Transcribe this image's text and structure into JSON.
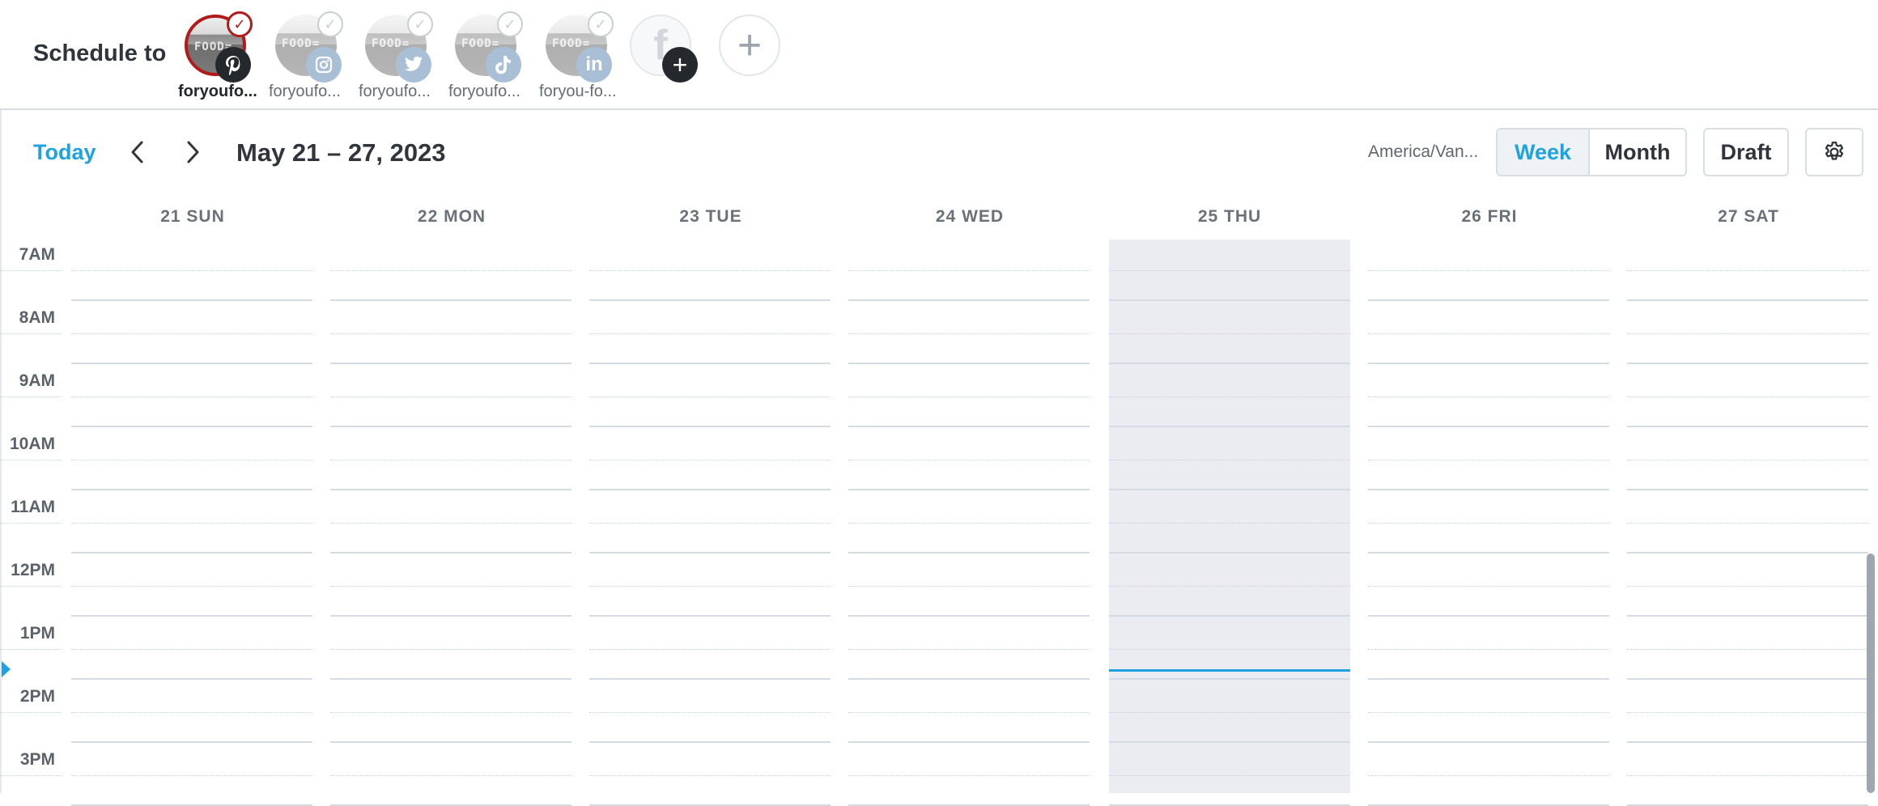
{
  "header": {
    "schedule_label": "Schedule to",
    "accounts": [
      {
        "name": "foryoufo...",
        "network_icon": "pinterest-icon",
        "selected": true
      },
      {
        "name": "foryoufo...",
        "network_icon": "instagram-icon",
        "selected": false
      },
      {
        "name": "foryoufo...",
        "network_icon": "twitter-icon",
        "selected": false
      },
      {
        "name": "foryoufo...",
        "network_icon": "tiktok-icon",
        "selected": false
      },
      {
        "name": "foryou-fo...",
        "network_icon": "linkedin-icon",
        "selected": false
      }
    ],
    "avatar_sign_text": "FOOD=",
    "add_facebook_icon": "facebook-icon",
    "add_account_icon": "plus-icon"
  },
  "toolbar": {
    "today_label": "Today",
    "date_range": "May 21 – 27, 2023",
    "timezone": "America/Van...",
    "view_options": [
      "Week",
      "Month"
    ],
    "active_view": "Week",
    "draft_label": "Draft",
    "settings_icon": "gear-icon"
  },
  "calendar": {
    "days": [
      "21 SUN",
      "22 MON",
      "23 TUE",
      "24 WED",
      "25 THU",
      "26 FRI",
      "27 SAT"
    ],
    "today_index": 4,
    "hours": [
      "7AM",
      "8AM",
      "9AM",
      "10AM",
      "11AM",
      "12PM",
      "1PM",
      "2PM",
      "3PM"
    ],
    "current_time_approx": "1:45PM"
  },
  "colors": {
    "accent": "#1fa3e0",
    "selected_account": "#b11b1b",
    "today_column": "#eaecf1",
    "text_dark": "#2f353b"
  }
}
